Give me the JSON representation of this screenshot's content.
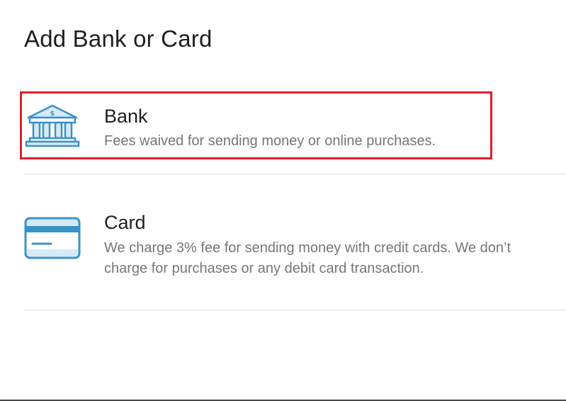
{
  "page": {
    "title": "Add Bank or Card"
  },
  "options": [
    {
      "label": "Bank",
      "description": "Fees waived for sending money or online purchases.",
      "icon": "bank-icon",
      "highlighted": true
    },
    {
      "label": "Card",
      "description": "We charge 3% fee for sending money with credit cards. We don’t charge for purchases or any debit card transaction.",
      "icon": "credit-card-icon",
      "highlighted": false
    }
  ],
  "colors": {
    "icon_accent": "#3a93c7",
    "icon_fill": "#d6eaf6",
    "highlight_border": "#e0202a",
    "title_text": "#1f1f1f",
    "description_text": "#767676",
    "divider": "#e2e2e2"
  }
}
